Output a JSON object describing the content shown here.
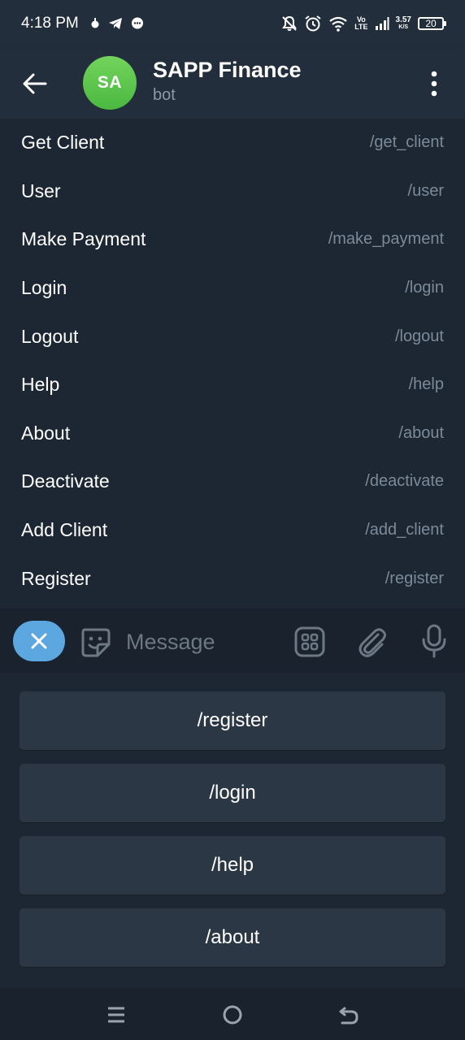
{
  "status_bar": {
    "time": "4:18 PM",
    "network_label_top": "Vo",
    "network_label_bottom": "LTE",
    "speed_value": "3.57",
    "speed_unit": "K/S",
    "battery": "20",
    "left_icons": [
      "notification-dot-icon",
      "telegram-icon",
      "chat-bubble-icon"
    ],
    "right_icons": [
      "bell-off-icon",
      "alarm-icon",
      "wifi-icon",
      "signal-icon",
      "battery-icon"
    ]
  },
  "header": {
    "avatar_initials": "SA",
    "title": "SAPP Finance",
    "subtitle": "bot"
  },
  "commands": [
    {
      "label": "Get Client",
      "command": "/get_client"
    },
    {
      "label": "User",
      "command": "/user"
    },
    {
      "label": "Make Payment",
      "command": "/make_payment"
    },
    {
      "label": "Login",
      "command": "/login"
    },
    {
      "label": "Logout",
      "command": "/logout"
    },
    {
      "label": "Help",
      "command": "/help"
    },
    {
      "label": "About",
      "command": "/about"
    },
    {
      "label": "Deactivate",
      "command": "/deactivate"
    },
    {
      "label": "Add Client",
      "command": "/add_client"
    },
    {
      "label": "Register",
      "command": "/register"
    }
  ],
  "input": {
    "placeholder": "Message"
  },
  "keyboard": {
    "buttons": [
      "/register",
      "/login",
      "/help",
      "/about"
    ]
  },
  "colors": {
    "background": "#1d2733",
    "header": "#232e3c",
    "accent": "#5ca7e0",
    "avatar": "#5cc64a",
    "muted_text": "#7c8a98",
    "keyboard_button": "#2b3745"
  }
}
